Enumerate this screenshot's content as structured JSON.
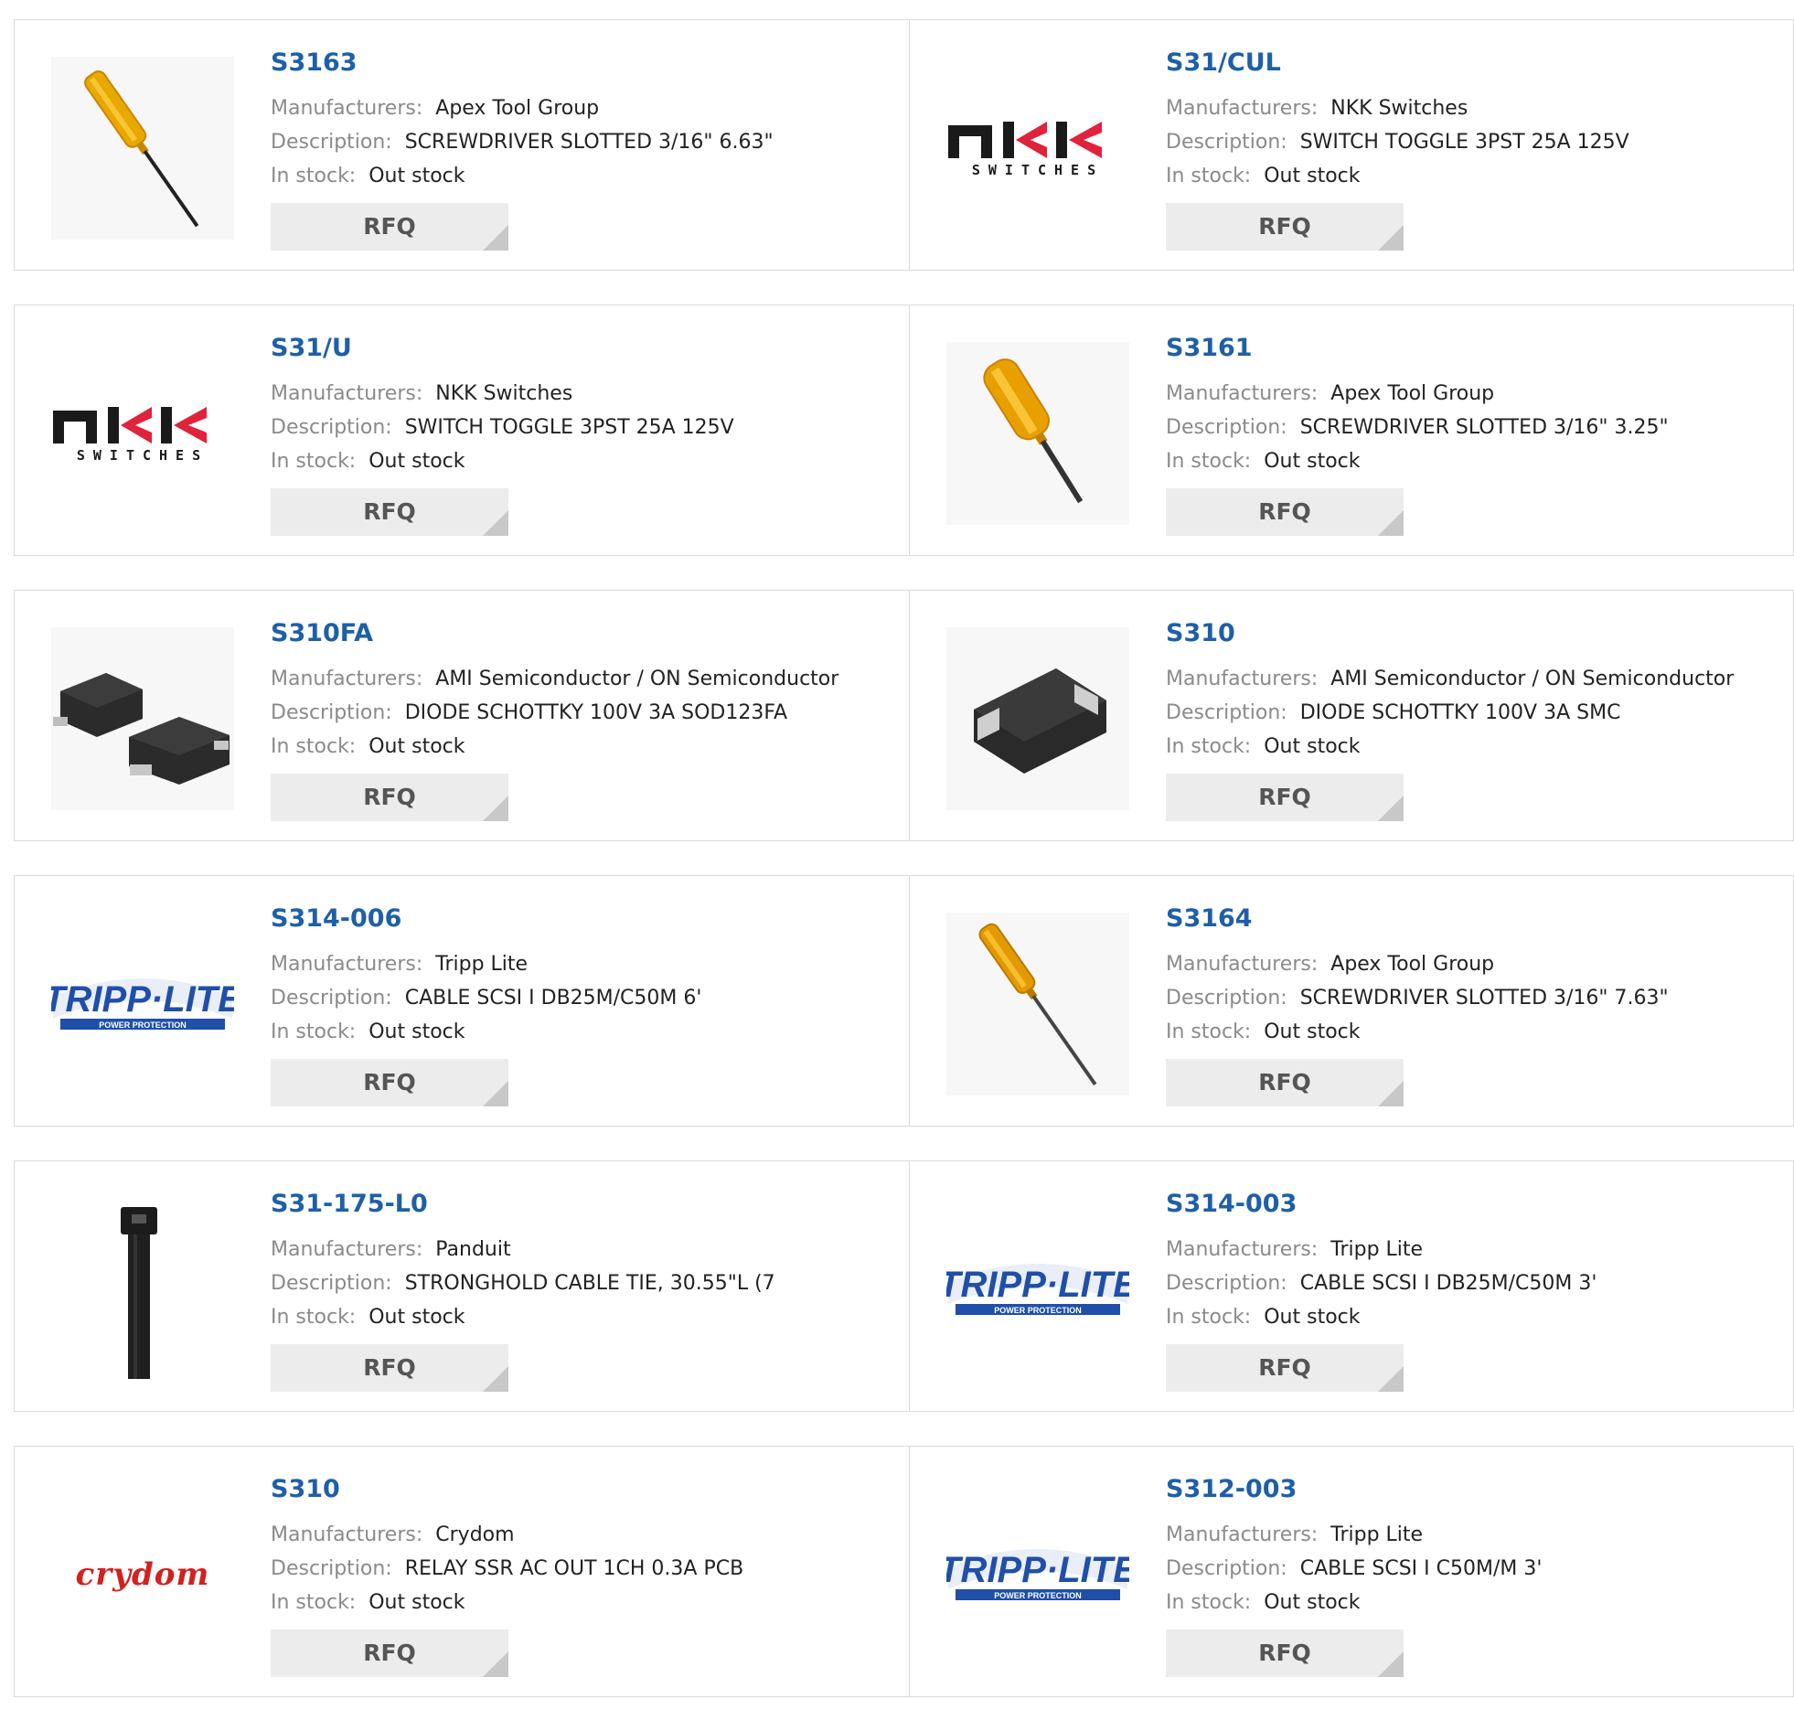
{
  "labels": {
    "manufacturers": "Manufacturers:",
    "description": "Description:",
    "stock": "In stock:",
    "rfq": "RFQ"
  },
  "logos": {
    "nkk_main": "nkk",
    "nkk_sub": "SWITCHES",
    "tripp_main": "TRIPP·LITE",
    "tripp_sub": "POWER PROTECTION",
    "crydom": "crydom"
  },
  "products": [
    {
      "part": "S3163",
      "manufacturer": "Apex Tool Group",
      "description": "SCREWDRIVER SLOTTED 3/16\" 6.63\"",
      "stock": "Out stock",
      "image": "screwdriver-long"
    },
    {
      "part": "S31/CUL",
      "manufacturer": "NKK Switches",
      "description": "SWITCH TOGGLE 3PST 25A 125V",
      "stock": "Out stock",
      "image": "nkk-logo"
    },
    {
      "part": "S31/U",
      "manufacturer": "NKK Switches",
      "description": "SWITCH TOGGLE 3PST 25A 125V",
      "stock": "Out stock",
      "image": "nkk-logo"
    },
    {
      "part": "S3161",
      "manufacturer": "Apex Tool Group",
      "description": "SCREWDRIVER SLOTTED 3/16\" 3.25\"",
      "stock": "Out stock",
      "image": "screwdriver-short"
    },
    {
      "part": "S310FA",
      "manufacturer": "AMI Semiconductor / ON Semiconductor",
      "description": "DIODE SCHOTTKY 100V 3A SOD123FA",
      "stock": "Out stock",
      "image": "diode-sod123"
    },
    {
      "part": "S310",
      "manufacturer": "AMI Semiconductor / ON Semiconductor",
      "description": "DIODE SCHOTTKY 100V 3A SMC",
      "stock": "Out stock",
      "image": "diode-smc"
    },
    {
      "part": "S314-006",
      "manufacturer": "Tripp Lite",
      "description": "CABLE SCSI I DB25M/C50M 6'",
      "stock": "Out stock",
      "image": "tripp-lite-logo"
    },
    {
      "part": "S3164",
      "manufacturer": "Apex Tool Group",
      "description": "SCREWDRIVER SLOTTED 3/16\" 7.63\"",
      "stock": "Out stock",
      "image": "screwdriver-long"
    },
    {
      "part": "S31-175-L0",
      "manufacturer": "Panduit",
      "description": "STRONGHOLD CABLE TIE, 30.55\"L (7",
      "stock": "Out stock",
      "image": "cable-tie"
    },
    {
      "part": "S314-003",
      "manufacturer": "Tripp Lite",
      "description": "CABLE SCSI I DB25M/C50M 3'",
      "stock": "Out stock",
      "image": "tripp-lite-logo"
    },
    {
      "part": "S310",
      "manufacturer": "Crydom",
      "description": "RELAY SSR AC OUT 1CH 0.3A PCB",
      "stock": "Out stock",
      "image": "crydom-logo"
    },
    {
      "part": "S312-003",
      "manufacturer": "Tripp Lite",
      "description": "CABLE SCSI I C50M/M 3'",
      "stock": "Out stock",
      "image": "tripp-lite-logo"
    }
  ]
}
